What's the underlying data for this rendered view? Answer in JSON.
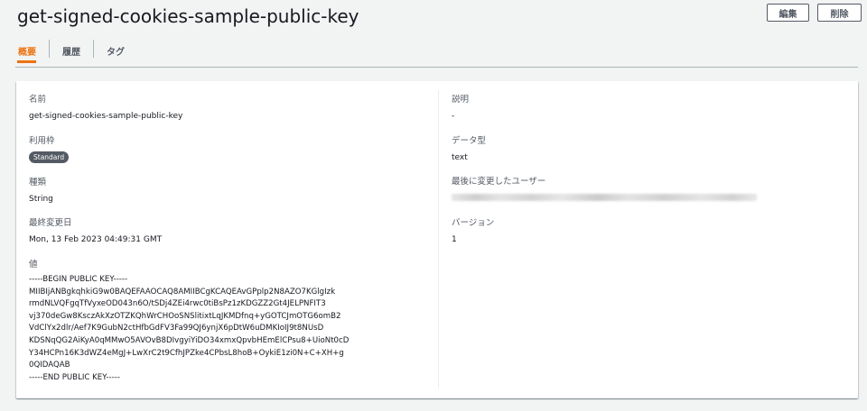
{
  "header": {
    "title": "get-signed-cookies-sample-public-key",
    "edit_label": "編集",
    "delete_label": "削除"
  },
  "tabs": [
    {
      "label": "概要",
      "active": true
    },
    {
      "label": "履歴",
      "active": false
    },
    {
      "label": "タグ",
      "active": false
    }
  ],
  "details": {
    "name": {
      "label": "名前",
      "value": "get-signed-cookies-sample-public-key"
    },
    "tier": {
      "label": "利用枠",
      "value": "Standard"
    },
    "type": {
      "label": "種類",
      "value": "String"
    },
    "last_modified": {
      "label": "最終変更日",
      "value": "Mon, 13 Feb 2023 04:49:31 GMT"
    },
    "value": {
      "label": "値",
      "value": "-----BEGIN PUBLIC KEY-----\nMIIBIjANBgkqhkiG9w0BAQEFAAOCAQ8AMIIBCgKCAQEAvGPplp2N8AZO7KGlgIzk\nrmdNLVQFgqTfVyxeOD043n6O/tSDj4ZEi4rwc0tiBsPz1zKDGZZ2Gt4JELPNFIT3\nvj370deGw8KsczAkXzOTZKQhWrCHOoSNSlitixtLqJKMDfnq+yGOTCJmOTG6omB2\nVdClYx2dlr/Aef7K9GubN2ctHfbGdFV3Fa99QJ6ynjX6pDtW6uDMKIoIJ9t8NUsD\nKDSNqQG2AiKyA0qMMwO5AVOvB8DIvgyiYiDO34xmxQpvbHEmElCPsu8+UioNt0cD\nY34HCPn16K3dWZ4eMgJ+LwXrC2t9CfhJPZke4CPbsL8hoB+OykiE1zi0N+C+XH+g\n0QIDAQAB\n-----END PUBLIC KEY-----"
    },
    "description": {
      "label": "説明",
      "value": "-"
    },
    "data_type": {
      "label": "データ型",
      "value": "text"
    },
    "last_modified_user": {
      "label": "最後に変更したユーザー"
    },
    "version": {
      "label": "バージョン",
      "value": "1"
    }
  },
  "colors": {
    "accent": "#ec7211",
    "badge": "#545b64",
    "background": "#f2f3f3"
  }
}
